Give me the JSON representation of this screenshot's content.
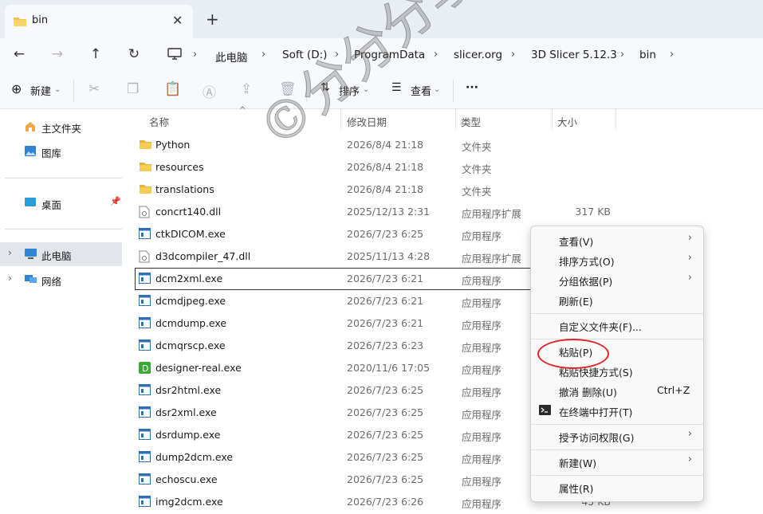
{
  "tab": {
    "title": "bin",
    "close": "✕",
    "new": "+"
  },
  "address": {
    "crumbs": [
      "此电脑",
      "Soft (D:)",
      "ProgramData",
      "slicer.org",
      "3D Slicer 5.12.3",
      "bin"
    ]
  },
  "toolbar": {
    "new_label": "新建",
    "sort_label": "排序",
    "view_label": "查看",
    "more": "···"
  },
  "sidebar": {
    "items": [
      {
        "label": "主文件夹"
      },
      {
        "label": "图库"
      },
      {
        "label": "桌面"
      },
      {
        "label": "此电脑"
      },
      {
        "label": "网络"
      }
    ]
  },
  "columns": {
    "name": "名称",
    "date": "修改日期",
    "type": "类型",
    "size": "大小"
  },
  "files": [
    {
      "name": "Python",
      "date": "2026/8/4 21:18",
      "type": "文件夹",
      "size": "",
      "kind": "folder"
    },
    {
      "name": "resources",
      "date": "2026/8/4 21:18",
      "type": "文件夹",
      "size": "",
      "kind": "folder"
    },
    {
      "name": "translations",
      "date": "2026/8/4 21:18",
      "type": "文件夹",
      "size": "",
      "kind": "folder"
    },
    {
      "name": "concrt140.dll",
      "date": "2025/12/13 2:31",
      "type": "应用程序扩展",
      "size": "317 KB",
      "kind": "dll"
    },
    {
      "name": "ctkDICOM.exe",
      "date": "2026/7/23 6:25",
      "type": "应用程序",
      "size": "",
      "kind": "exe"
    },
    {
      "name": "d3dcompiler_47.dll",
      "date": "2025/11/13 4:28",
      "type": "应用程序扩展",
      "size": "",
      "kind": "dll"
    },
    {
      "name": "dcm2xml.exe",
      "date": "2026/7/23 6:21",
      "type": "应用程序",
      "size": "",
      "kind": "exe"
    },
    {
      "name": "dcmdjpeg.exe",
      "date": "2026/7/23 6:21",
      "type": "应用程序",
      "size": "",
      "kind": "exe"
    },
    {
      "name": "dcmdump.exe",
      "date": "2026/7/23 6:21",
      "type": "应用程序",
      "size": "",
      "kind": "exe"
    },
    {
      "name": "dcmqrscp.exe",
      "date": "2026/7/23 6:23",
      "type": "应用程序",
      "size": "",
      "kind": "exe"
    },
    {
      "name": "designer-real.exe",
      "date": "2020/11/6 17:05",
      "type": "应用程序",
      "size": "",
      "kind": "designer"
    },
    {
      "name": "dsr2html.exe",
      "date": "2026/7/23 6:25",
      "type": "应用程序",
      "size": "",
      "kind": "exe"
    },
    {
      "name": "dsr2xml.exe",
      "date": "2026/7/23 6:25",
      "type": "应用程序",
      "size": "",
      "kind": "exe"
    },
    {
      "name": "dsrdump.exe",
      "date": "2026/7/23 6:25",
      "type": "应用程序",
      "size": "",
      "kind": "exe"
    },
    {
      "name": "dump2dcm.exe",
      "date": "2026/7/23 6:25",
      "type": "应用程序",
      "size": "",
      "kind": "exe"
    },
    {
      "name": "echoscu.exe",
      "date": "2026/7/23 6:25",
      "type": "应用程序",
      "size": "",
      "kind": "exe"
    },
    {
      "name": "img2dcm.exe",
      "date": "2026/7/23 6:26",
      "type": "应用程序",
      "size": "45 KB",
      "kind": "exe"
    }
  ],
  "context_menu": {
    "view": "查看(V)",
    "sort": "排序方式(O)",
    "group": "分组依据(P)",
    "refresh": "刷新(E)",
    "customize": "自定义文件夹(F)...",
    "paste": "粘贴(P)",
    "paste_shortcut": "粘贴快捷方式(S)",
    "undo_delete": "撤消 删除(U)",
    "undo_shortcut": "Ctrl+Z",
    "open_terminal": "在终端中打开(T)",
    "grant_access": "授予访问权限(G)",
    "new": "新建(W)",
    "properties": "属性(R)"
  },
  "watermark": "©分分分享科研软件分享",
  "colors": {
    "folder": "#f4c245",
    "exe_icon": "#2f6fb3",
    "designer": "#3aaa35",
    "highlight_circle": "#e0262b",
    "selection": "#e2e5ea"
  }
}
